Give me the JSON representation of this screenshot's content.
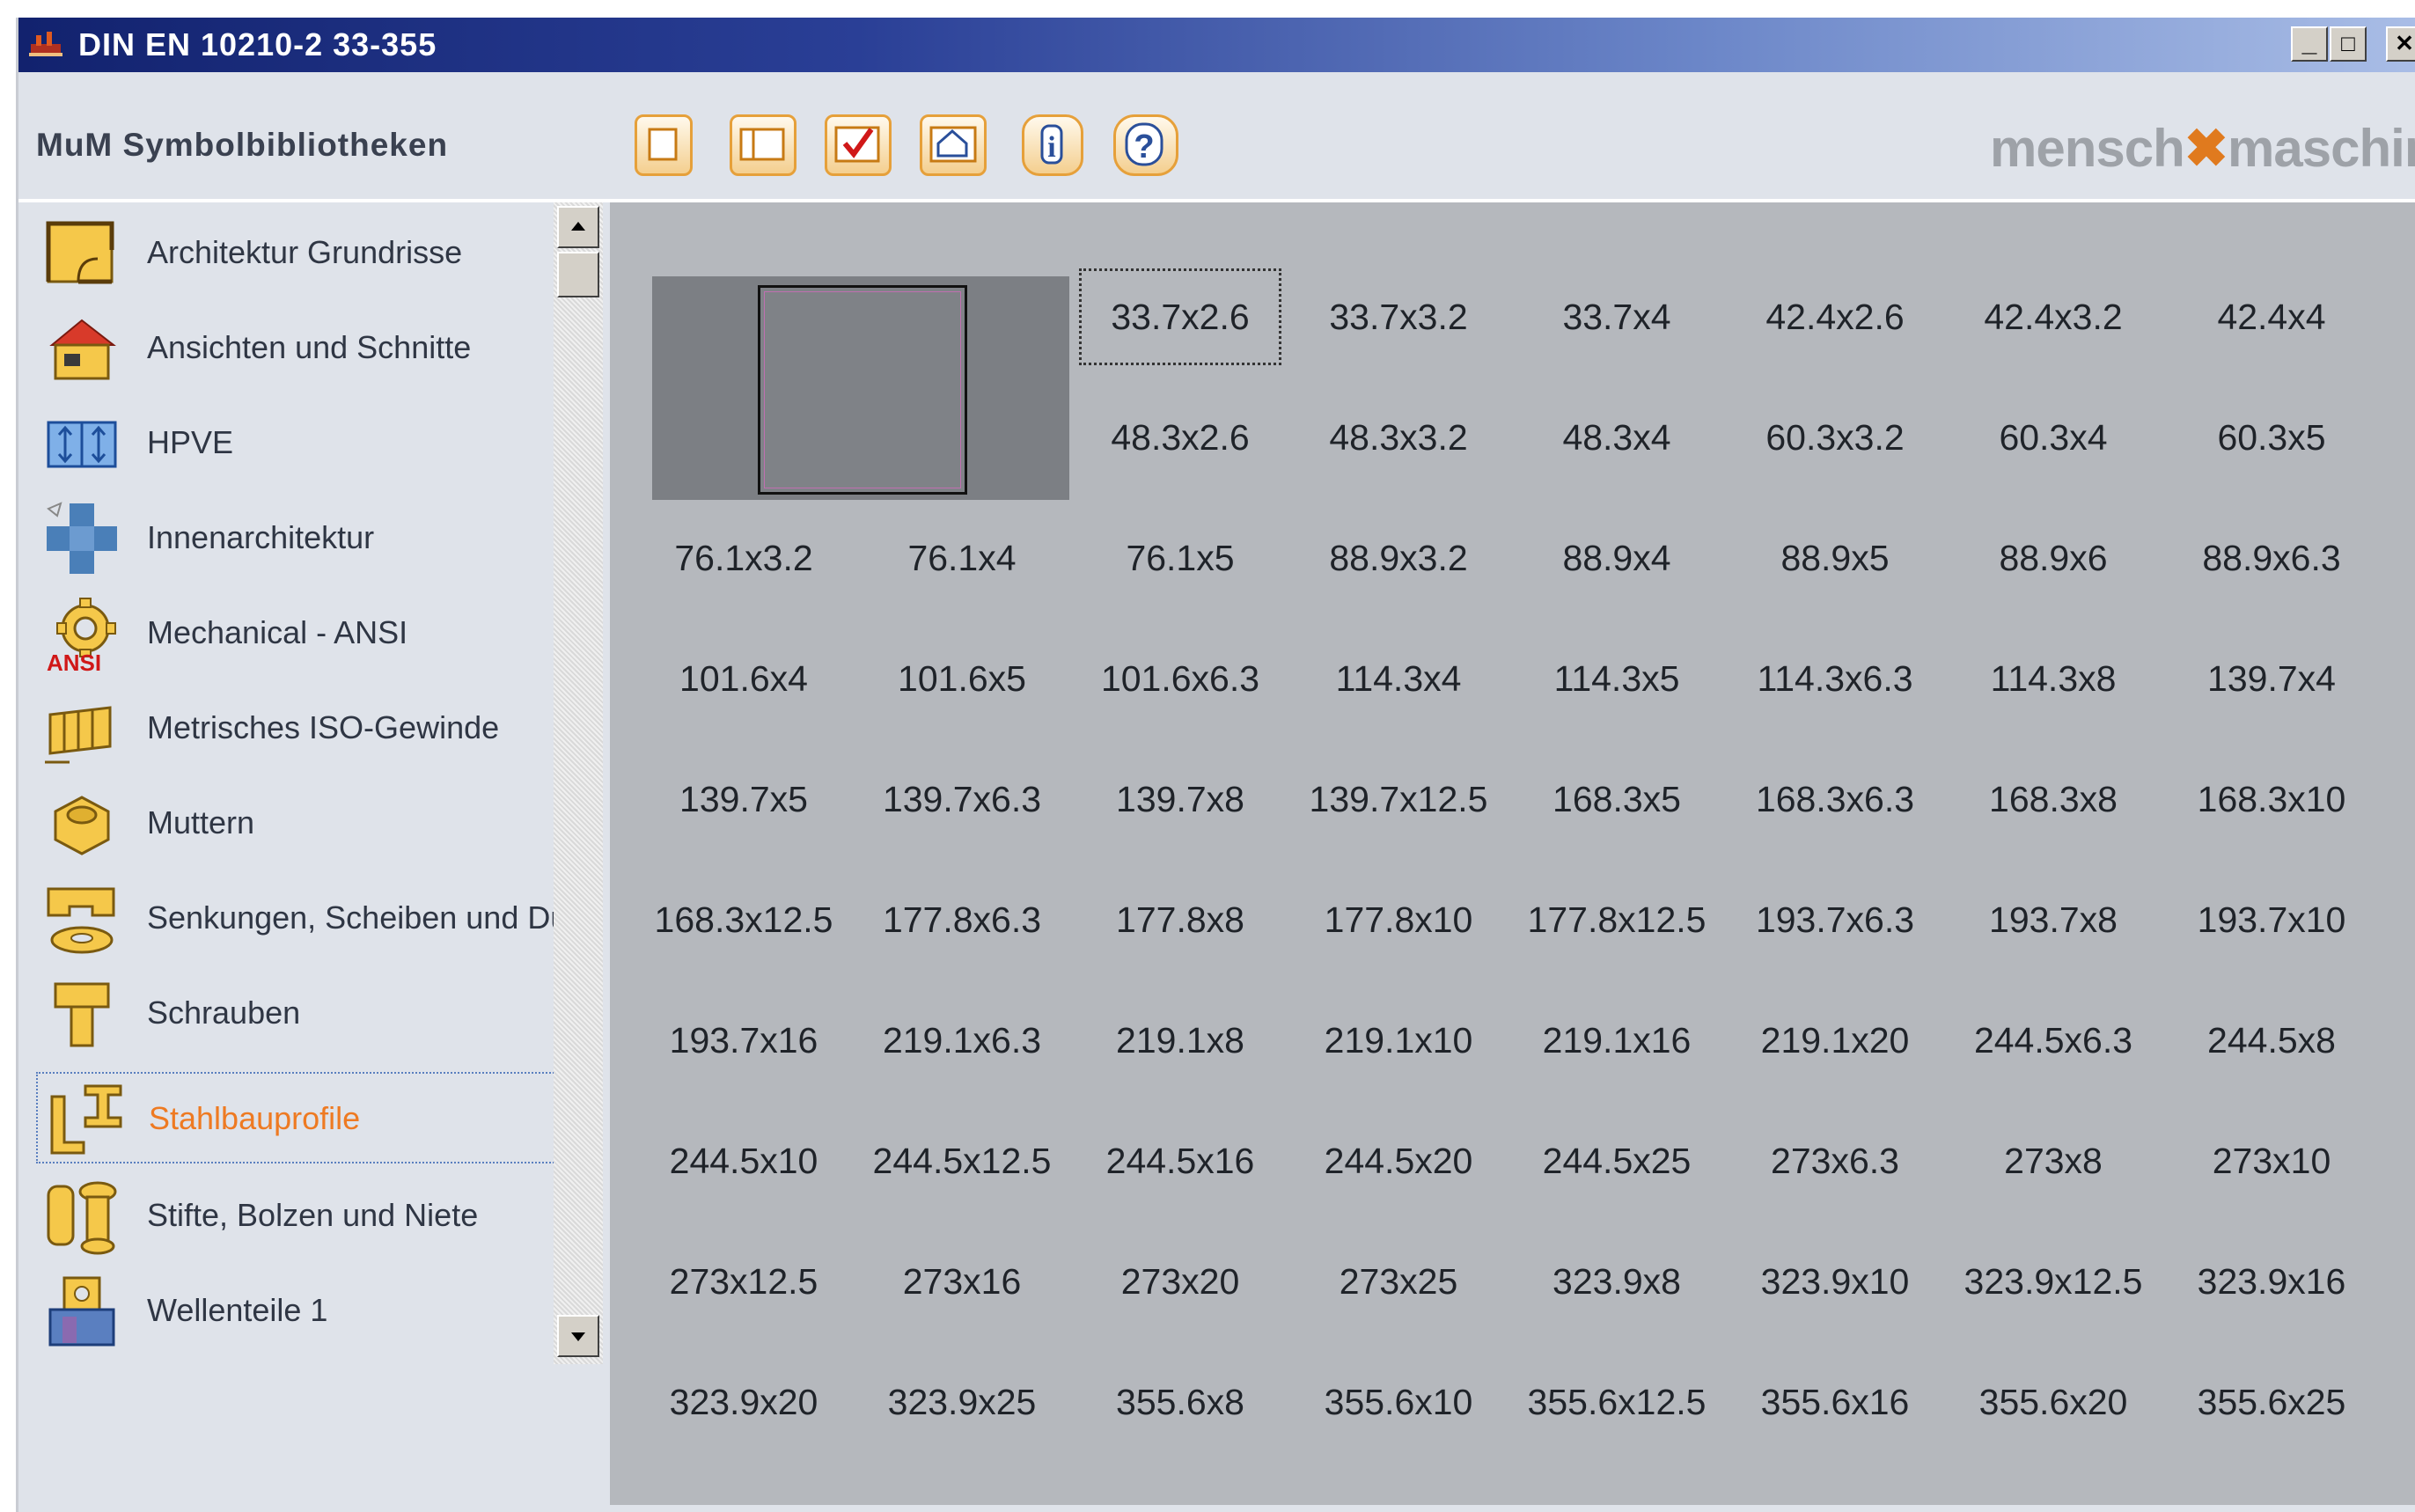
{
  "window": {
    "title": "DIN EN 10210-2 33-355",
    "minimize": "_",
    "maximize": "□",
    "close": "✕"
  },
  "header": {
    "library_title": "MuM Symbolbibliotheken",
    "brand_left": "mensch",
    "brand_mark": "✖",
    "brand_right": "maschine",
    "info_glyph": "i",
    "help_glyph": "?"
  },
  "sidebar": {
    "items": [
      {
        "label": "Architektur Grundrisse",
        "icon": "floorplan-icon"
      },
      {
        "label": "Ansichten und Schnitte",
        "icon": "house-icon"
      },
      {
        "label": "HPVE",
        "icon": "hpve-icon"
      },
      {
        "label": "Innenarchitektur",
        "icon": "interior-icon"
      },
      {
        "label": "Mechanical - ANSI",
        "icon": "gear-ansi-icon"
      },
      {
        "label": "Metrisches ISO-Gewinde",
        "icon": "thread-icon"
      },
      {
        "label": "Muttern",
        "icon": "nut-icon"
      },
      {
        "label": "Senkungen, Scheiben und Du",
        "icon": "washer-icon"
      },
      {
        "label": "Schrauben",
        "icon": "screw-icon"
      },
      {
        "label": "Stahlbauprofile",
        "icon": "steel-profile-icon",
        "active": true
      },
      {
        "label": "Stifte, Bolzen und Niete",
        "icon": "pin-icon"
      },
      {
        "label": "Wellenteile 1",
        "icon": "shaft-icon"
      }
    ],
    "ansi_badge": "ANSI"
  },
  "grid": {
    "selected": "33.7x2.6",
    "rows": [
      [
        "33.7x2.6",
        "33.7x3.2",
        "33.7x4",
        "42.4x2.6",
        "42.4x3.2",
        "42.4x4"
      ],
      [
        "48.3x2.6",
        "48.3x3.2",
        "48.3x4",
        "60.3x3.2",
        "60.3x4",
        "60.3x5"
      ],
      [
        "76.1x3.2",
        "76.1x4",
        "76.1x5",
        "88.9x3.2",
        "88.9x4",
        "88.9x5",
        "88.9x6",
        "88.9x6.3"
      ],
      [
        "101.6x4",
        "101.6x5",
        "101.6x6.3",
        "114.3x4",
        "114.3x5",
        "114.3x6.3",
        "114.3x8",
        "139.7x4"
      ],
      [
        "139.7x5",
        "139.7x6.3",
        "139.7x8",
        "139.7x12.5",
        "168.3x5",
        "168.3x6.3",
        "168.3x8",
        "168.3x10"
      ],
      [
        "168.3x12.5",
        "177.8x6.3",
        "177.8x8",
        "177.8x10",
        "177.8x12.5",
        "193.7x6.3",
        "193.7x8",
        "193.7x10"
      ],
      [
        "193.7x16",
        "219.1x6.3",
        "219.1x8",
        "219.1x10",
        "219.1x16",
        "219.1x20",
        "244.5x6.3",
        "244.5x8"
      ],
      [
        "244.5x10",
        "244.5x12.5",
        "244.5x16",
        "244.5x20",
        "244.5x25",
        "273x6.3",
        "273x8",
        "273x10"
      ],
      [
        "273x12.5",
        "273x16",
        "273x20",
        "273x25",
        "323.9x8",
        "323.9x10",
        "323.9x12.5",
        "323.9x16"
      ],
      [
        "323.9x20",
        "323.9x25",
        "355.6x8",
        "355.6x10",
        "355.6x12.5",
        "355.6x16",
        "355.6x20",
        "355.6x25"
      ]
    ]
  },
  "colors": {
    "accent_orange": "#ee7a22",
    "titlebar_dark": "#12226e",
    "grid_bg": "#b5b8bd"
  }
}
